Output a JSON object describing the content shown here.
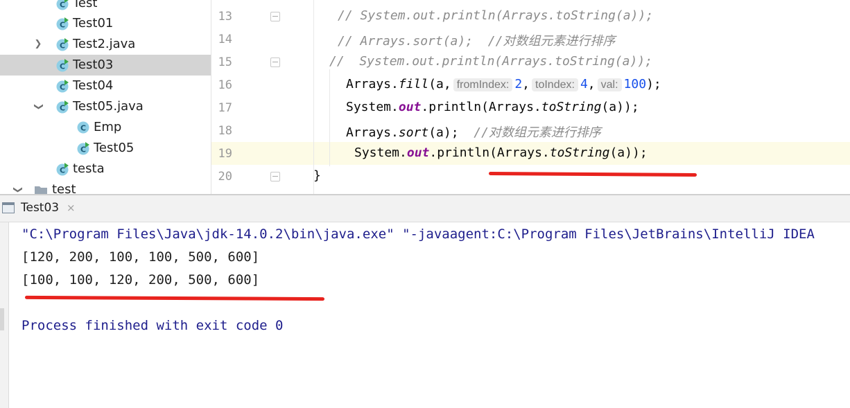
{
  "project_tree": {
    "items": [
      {
        "label": "Test",
        "icon": "java-class-icon"
      },
      {
        "label": "Test01",
        "icon": "java-class-icon"
      },
      {
        "label": "Test2.java",
        "icon": "java-class-icon",
        "collapsed": true
      },
      {
        "label": "Test03",
        "icon": "java-class-icon",
        "selected": true
      },
      {
        "label": "Test04",
        "icon": "java-class-icon"
      },
      {
        "label": "Test05.java",
        "icon": "java-class-icon",
        "expanded": true
      },
      {
        "label": "Emp",
        "icon": "class-icon"
      },
      {
        "label": "Test05",
        "icon": "java-class-icon"
      },
      {
        "label": "testa",
        "icon": "java-class-icon"
      },
      {
        "label": "test",
        "icon": "folder-icon",
        "expanded": true
      }
    ]
  },
  "editor": {
    "line_numbers": [
      "13",
      "14",
      "15",
      "16",
      "17",
      "18",
      "19",
      "20"
    ],
    "lines": {
      "l13": "// System.out.println(Arrays.toString(a));",
      "l14": "// Arrays.sort(a);  //对数组元素进行排序",
      "l15": "//  System.out.println(Arrays.toString(a));",
      "l16": {
        "pre": "Arrays.",
        "method": "fill",
        "open": "(a,",
        "hint1": "fromIndex:",
        "v1": "2",
        "hint2": "toIndex:",
        "v2": "4",
        "hint3": "val:",
        "v3": "100",
        "close": ");"
      },
      "l17": {
        "pre": "System.",
        "out": "out",
        "mid": ".println(Arrays.",
        "method": "toString",
        "end": "(a));"
      },
      "l18": {
        "pre": "Arrays.",
        "method": "sort",
        "mid": "(a);  ",
        "comment": "//对数组元素进行排序"
      },
      "l19": {
        "pre": "System.",
        "out": "out",
        "mid": ".println(Arrays.",
        "method": "toString",
        "end": "(a));"
      },
      "l20": "}"
    }
  },
  "run_panel": {
    "tab_label": "Test03",
    "tab_close": "×",
    "output": [
      "\"C:\\Program Files\\Java\\jdk-14.0.2\\bin\\java.exe\" \"-javaagent:C:\\Program Files\\JetBrains\\IntelliJ IDEA",
      "[120, 200, 100, 100, 500, 600]",
      "[100, 100, 120, 200, 500, 600]",
      "Process finished with exit code 0"
    ],
    "output_color": "#1e1e8c"
  },
  "colors": {
    "annotation_red": "#e8231e",
    "selection": "#d4d4d4",
    "current_line": "#fdfbe6"
  }
}
